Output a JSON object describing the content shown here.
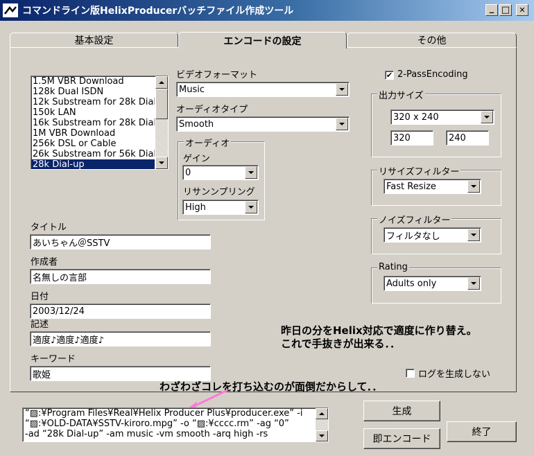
{
  "window": {
    "title": "コマンドライン版HelixProducerバッチファイル作成ツール",
    "minimize": "_",
    "maximize": "□",
    "close": "✕"
  },
  "tabs": [
    {
      "label": "基本設定"
    },
    {
      "label": "エンコードの設定"
    },
    {
      "label": "その他"
    }
  ],
  "audience_list": {
    "items": [
      "1.5M VBR Download",
      "128k Dual ISDN",
      "12k Substream for 28k Dial-up",
      "150k LAN",
      "16k Substream for 28k Dial-up",
      "1M VBR Download",
      "256k DSL or Cable",
      "26k Substream for 56k Dial-up",
      "28k Dial-up"
    ],
    "selected": "28k Dial-up"
  },
  "video_format": {
    "label": "ビデオフォーマット",
    "value": "Music"
  },
  "audio_type": {
    "label": "オーディオタイプ",
    "value": "Smooth"
  },
  "audio_group": {
    "title": "オーディオ",
    "gain_label": "ゲイン",
    "gain_value": "0",
    "resample_label": "リサンンプリング",
    "resample_value": "High"
  },
  "two_pass": {
    "label": "2-PassEncoding",
    "checked": true
  },
  "output_size": {
    "title": "出力サイズ",
    "preset": "320 x 240",
    "width": "320",
    "height": "240"
  },
  "resize_filter": {
    "title": "リサイズフィルター",
    "value": "Fast Resize"
  },
  "noise_filter": {
    "title": "ノイズフィルター",
    "value": "フィルタなし"
  },
  "rating": {
    "title": "Rating",
    "value": "Adults only"
  },
  "metadata": {
    "title_label": "タイトル",
    "title_value": "あいちゃん＠SSTV",
    "author_label": "作成者",
    "author_value": "名無しの言部",
    "date_label": "日付",
    "date_value": "2003/12/24",
    "desc_label": "記述",
    "desc_value": "適度♪適度♪適度♪",
    "keyword_label": "キーワード",
    "keyword_value": "歌姫"
  },
  "annotation_1": "昨日の分をHelix対応で適度に作り替え。",
  "annotation_2": "これで手抜きが出来る．．",
  "annotation_3": "わざわざコレを打ち込むのが面倒だからして．．",
  "no_log": {
    "label": "ログを生成しない",
    "checked": false
  },
  "command": [
    "“▨:¥Program Files¥Real¥Helix Producer Plus¥producer.exe” -i",
    "“▨:¥OLD-DATA¥SSTV-kiroro.mpg” -o “▨:¥cccc.rm” -ag “0”",
    "-ad “28k Dial-up” -am music -vm smooth -arq high -rs"
  ],
  "buttons": {
    "generate": "生成",
    "encode_now": "即エンコード",
    "exit": "終了"
  },
  "colors": {
    "accent_pink": "#ff7ad8",
    "selection": "#0a246a",
    "titlebar": "#0a246a"
  }
}
